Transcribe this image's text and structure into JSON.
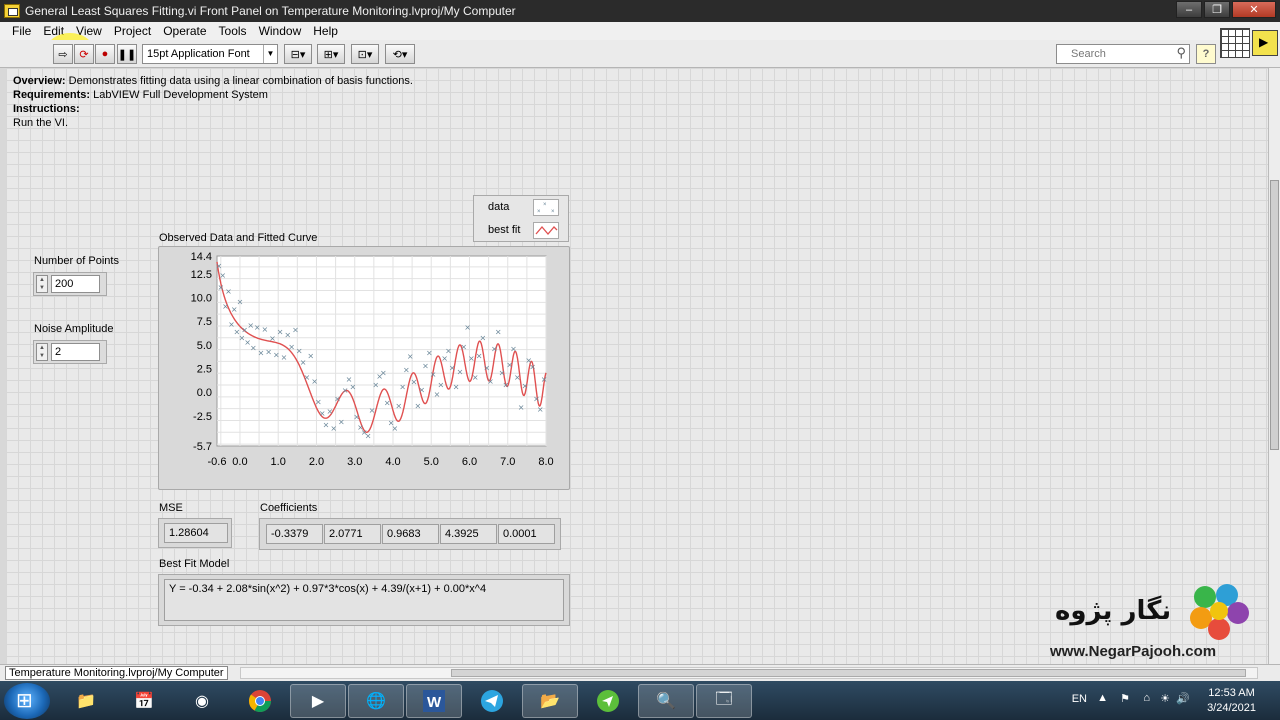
{
  "window": {
    "title": "General Least Squares Fitting.vi Front Panel on Temperature Monitoring.lvproj/My Computer"
  },
  "menu": [
    "File",
    "Edit",
    "View",
    "Project",
    "Operate",
    "Tools",
    "Window",
    "Help"
  ],
  "toolbar": {
    "font": "15pt Application Font",
    "search_placeholder": "Search",
    "help_label": "?"
  },
  "description": {
    "overview_label": "Overview:",
    "overview_text": " Demonstrates fitting data using a linear combination of basis functions.",
    "requirements_label": "Requirements:",
    "requirements_text": " LabVIEW Full Development System",
    "instructions_label": "Instructions:",
    "instructions_text": "Run the VI."
  },
  "controls": {
    "num_points_label": "Number of Points",
    "num_points_value": "200",
    "noise_label": "Noise Amplitude",
    "noise_value": "2"
  },
  "legend": {
    "data_label": "data",
    "fit_label": "best fit"
  },
  "chart_data": {
    "type": "scatter",
    "title": "Observed Data and Fitted Curve",
    "xlim": [
      -0.6,
      8.0
    ],
    "ylim": [
      -5.7,
      14.4
    ],
    "x_ticks": [
      "-0.6",
      "0.0",
      "1.0",
      "2.0",
      "3.0",
      "4.0",
      "5.0",
      "6.0",
      "7.0",
      "8.0"
    ],
    "y_ticks": [
      "14.4",
      "12.5",
      "10.0",
      "7.5",
      "5.0",
      "2.5",
      "0.0",
      "-2.5",
      "-5.7"
    ],
    "series": [
      {
        "name": "data",
        "marker": "x",
        "color": "#6a8799",
        "points": [
          [
            -0.55,
            13.4
          ],
          [
            -0.5,
            11.1
          ],
          [
            -0.45,
            12.4
          ],
          [
            -0.38,
            9.1
          ],
          [
            -0.3,
            10.7
          ],
          [
            -0.22,
            7.2
          ],
          [
            -0.15,
            8.8
          ],
          [
            -0.08,
            6.4
          ],
          [
            0.0,
            9.6
          ],
          [
            0.05,
            5.8
          ],
          [
            0.12,
            6.6
          ],
          [
            0.2,
            5.3
          ],
          [
            0.28,
            7.1
          ],
          [
            0.35,
            4.7
          ],
          [
            0.45,
            6.9
          ],
          [
            0.55,
            4.2
          ],
          [
            0.65,
            6.7
          ],
          [
            0.75,
            4.3
          ],
          [
            0.85,
            5.7
          ],
          [
            0.95,
            4.0
          ],
          [
            1.05,
            6.4
          ],
          [
            1.15,
            3.7
          ],
          [
            1.25,
            6.1
          ],
          [
            1.35,
            4.8
          ],
          [
            1.45,
            6.6
          ],
          [
            1.55,
            4.4
          ],
          [
            1.65,
            3.2
          ],
          [
            1.75,
            1.6
          ],
          [
            1.85,
            3.9
          ],
          [
            1.95,
            1.2
          ],
          [
            2.05,
            -1.0
          ],
          [
            2.15,
            -2.2
          ],
          [
            2.25,
            -3.4
          ],
          [
            2.35,
            -2.0
          ],
          [
            2.45,
            -3.8
          ],
          [
            2.55,
            -0.7
          ],
          [
            2.65,
            -3.1
          ],
          [
            2.75,
            0.2
          ],
          [
            2.85,
            1.4
          ],
          [
            2.95,
            0.6
          ],
          [
            3.05,
            -2.6
          ],
          [
            3.15,
            -3.7
          ],
          [
            3.25,
            -4.2
          ],
          [
            3.35,
            -4.6
          ],
          [
            3.45,
            -1.9
          ],
          [
            3.55,
            0.8
          ],
          [
            3.65,
            1.7
          ],
          [
            3.75,
            2.1
          ],
          [
            3.85,
            -1.1
          ],
          [
            3.95,
            -3.2
          ],
          [
            4.05,
            -3.8
          ],
          [
            4.15,
            -1.4
          ],
          [
            4.25,
            0.6
          ],
          [
            4.35,
            2.4
          ],
          [
            4.45,
            3.8
          ],
          [
            4.55,
            1.1
          ],
          [
            4.65,
            -1.4
          ],
          [
            4.75,
            0.3
          ],
          [
            4.85,
            2.8
          ],
          [
            4.95,
            4.2
          ],
          [
            5.05,
            1.9
          ],
          [
            5.15,
            -0.2
          ],
          [
            5.25,
            0.8
          ],
          [
            5.35,
            3.6
          ],
          [
            5.45,
            4.4
          ],
          [
            5.55,
            2.6
          ],
          [
            5.65,
            0.6
          ],
          [
            5.75,
            2.2
          ],
          [
            5.85,
            4.8
          ],
          [
            5.95,
            6.9
          ],
          [
            6.05,
            3.6
          ],
          [
            6.15,
            1.6
          ],
          [
            6.25,
            3.9
          ],
          [
            6.35,
            5.8
          ],
          [
            6.45,
            2.6
          ],
          [
            6.55,
            1.2
          ],
          [
            6.65,
            4.6
          ],
          [
            6.75,
            6.4
          ],
          [
            6.85,
            2.1
          ],
          [
            6.95,
            0.8
          ],
          [
            7.05,
            2.9
          ],
          [
            7.15,
            4.6
          ],
          [
            7.25,
            1.6
          ],
          [
            7.35,
            -1.6
          ],
          [
            7.45,
            0.7
          ],
          [
            7.55,
            3.4
          ],
          [
            7.65,
            2.7
          ],
          [
            7.75,
            -0.7
          ],
          [
            7.85,
            -1.8
          ],
          [
            7.95,
            1.4
          ]
        ]
      },
      {
        "name": "best fit",
        "color": "#e05050",
        "model": {
          "terms": [
            "sin(x^2)",
            "3*cos(x)",
            "1/(x+1)",
            "x^4"
          ],
          "coefficients": [
            -0.3379,
            2.0771,
            0.9683,
            4.3925,
            0.0001
          ]
        }
      }
    ]
  },
  "indicators": {
    "mse_label": "MSE",
    "mse_value": "1.28604",
    "coeff_label": "Coefficients",
    "coefficients": [
      "-0.3379",
      "2.0771",
      "0.9683",
      "4.3925",
      "0.0001"
    ],
    "model_label": "Best Fit Model",
    "model_value": "Y = -0.34 + 2.08*sin(x^2) + 0.97*3*cos(x) + 4.39/(x+1) + 0.00*x^4"
  },
  "status": {
    "context": "Temperature Monitoring.lvproj/My Computer"
  },
  "watermark": {
    "text": "نگار پژوه",
    "url": "www.NegarPajooh.com"
  },
  "taskbar": {
    "language": "EN",
    "time": "12:53 AM",
    "date": "3/24/2021"
  }
}
